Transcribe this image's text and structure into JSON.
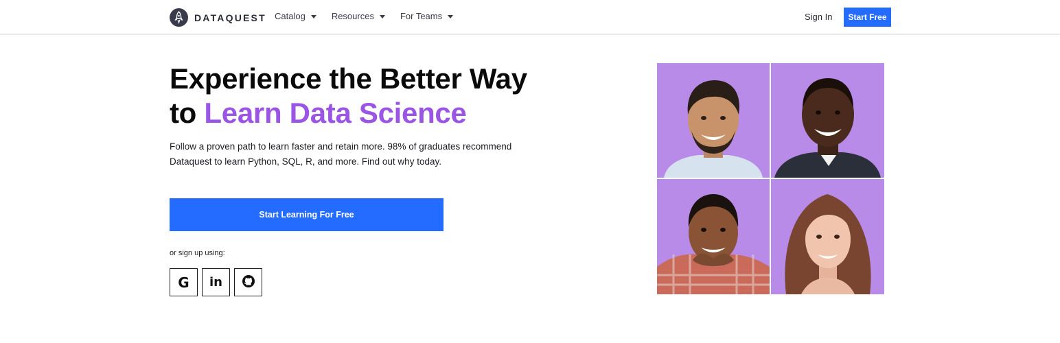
{
  "header": {
    "brand": "DATAQUEST",
    "nav": [
      {
        "label": "Catalog"
      },
      {
        "label": "Resources"
      },
      {
        "label": "For Teams"
      }
    ],
    "sign_in": "Sign In",
    "start_free": "Start Free"
  },
  "hero": {
    "headline_line1": "Experience the Better Way",
    "headline_prefix": "to ",
    "headline_accent": "Learn Data Science",
    "subtext": "Follow a proven path to learn faster and retain more. 98% of graduates recommend Dataquest to learn Python, SQL, R, and more. Find out why today.",
    "cta": "Start Learning For Free",
    "signup_label": "or sign up using:",
    "socials": [
      {
        "icon": "google-icon",
        "glyph": "G"
      },
      {
        "icon": "linkedin-icon",
        "glyph": "in"
      },
      {
        "icon": "github-icon",
        "glyph": ""
      }
    ]
  },
  "colors": {
    "primary": "#246bff",
    "accent": "#9a55e4",
    "tile_background": "#b98be9",
    "brand_dark": "#393a4c"
  }
}
